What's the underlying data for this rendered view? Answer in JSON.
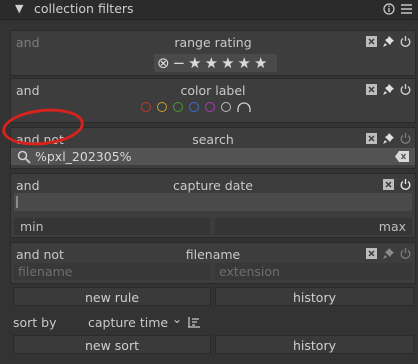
{
  "header": {
    "title": "collection filters",
    "arrow": "▼"
  },
  "rules": [
    {
      "conj": "and",
      "title": "range rating"
    },
    {
      "conj": "and",
      "title": "color label"
    },
    {
      "conj": "and not",
      "title": "search",
      "search_value": "%pxl_202305%"
    },
    {
      "conj": "and",
      "title": "capture date",
      "min_label": "min",
      "max_label": "max"
    },
    {
      "conj": "and not",
      "title": "filename",
      "filename_placeholder": "filename",
      "extension_placeholder": "extension"
    }
  ],
  "rating": {
    "reject": "⊗",
    "minus": "−",
    "stars": [
      "★",
      "★",
      "★",
      "★",
      "★"
    ]
  },
  "color_labels": [
    {
      "name": "red",
      "color": "#c0392b"
    },
    {
      "name": "yellow",
      "color": "#c9a227"
    },
    {
      "name": "green",
      "color": "#4a9a3a"
    },
    {
      "name": "blue",
      "color": "#3b6fd6"
    },
    {
      "name": "purple",
      "color": "#b03ab8"
    },
    {
      "name": "gray",
      "color": "#bcbcbc"
    }
  ],
  "buttons": {
    "new_rule": "new rule",
    "history": "history",
    "new_sort": "new sort",
    "history2": "history"
  },
  "sort": {
    "label": "sort by",
    "value": "capture time",
    "chevron": "⌄"
  },
  "accent": "#d8221c"
}
